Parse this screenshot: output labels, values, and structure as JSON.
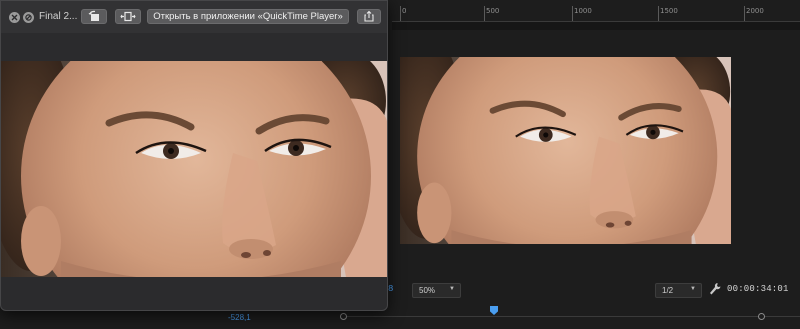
{
  "quicktime_window": {
    "title": "Final 2...",
    "open_in_app_label": "Открыть в приложении «QuickTime Player»"
  },
  "premiere": {
    "ruler": {
      "labels": [
        "0",
        "500",
        "1000",
        "1500",
        "2000"
      ]
    },
    "zoom": {
      "selected": "50%"
    },
    "resolution": {
      "selected": "1/2"
    },
    "timecode": "00:00:34:01",
    "timecode_left_fragment": "8",
    "lower_value": "-528,1"
  },
  "colors": {
    "accent_blue": "#4a9ef0",
    "panel_bg": "#1d1d1d",
    "window_bg": "#2b2b2d"
  },
  "icons": {
    "close": "close-icon",
    "fullscreen": "fullscreen-icon",
    "rotate": "rotate-icon",
    "trim": "trim-icon",
    "share": "share-icon",
    "wrench": "wrench-icon"
  }
}
